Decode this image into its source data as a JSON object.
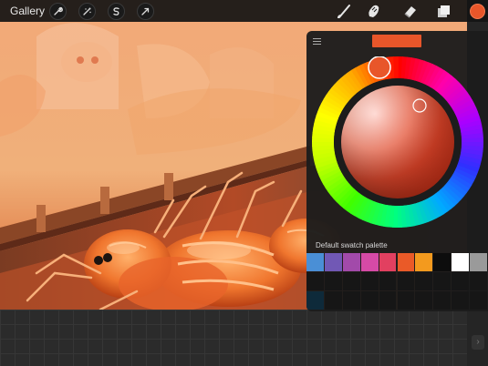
{
  "toolbar": {
    "gallery_label": "Gallery",
    "left_tools": [
      {
        "name": "wrench-icon",
        "label": "Actions"
      },
      {
        "name": "magic-wand-icon",
        "label": "Adjustments"
      },
      {
        "name": "selection-s-icon",
        "label": "Selection"
      },
      {
        "name": "arrow-cursor-icon",
        "label": "Transform"
      }
    ],
    "right_tools": [
      {
        "name": "brush-icon",
        "label": "Paint"
      },
      {
        "name": "smudge-icon",
        "label": "Smudge"
      },
      {
        "name": "eraser-icon",
        "label": "Erase"
      },
      {
        "name": "layers-icon",
        "label": "Layers"
      }
    ],
    "current_color": "#e8562a"
  },
  "color_panel": {
    "current_color": "#e8562a",
    "palette_label": "Default swatch palette",
    "swatches_row1": [
      "#4a8fd6",
      "#7158b5",
      "#a24aaa",
      "#d64aa6",
      "#e24060",
      "#ea5a28",
      "#f39a1e",
      "#0d0d0d",
      "#ffffff",
      "#9a9a9a"
    ],
    "swatches_row2": [
      "#0e2a3a"
    ],
    "hue_ring": [
      "#ff0000",
      "#ff00aa",
      "#aa00ff",
      "#3030ff",
      "#00aaff",
      "#00ff80",
      "#40ff00",
      "#c0ff00",
      "#ffff00",
      "#ffaa00",
      "#ff0000"
    ]
  }
}
